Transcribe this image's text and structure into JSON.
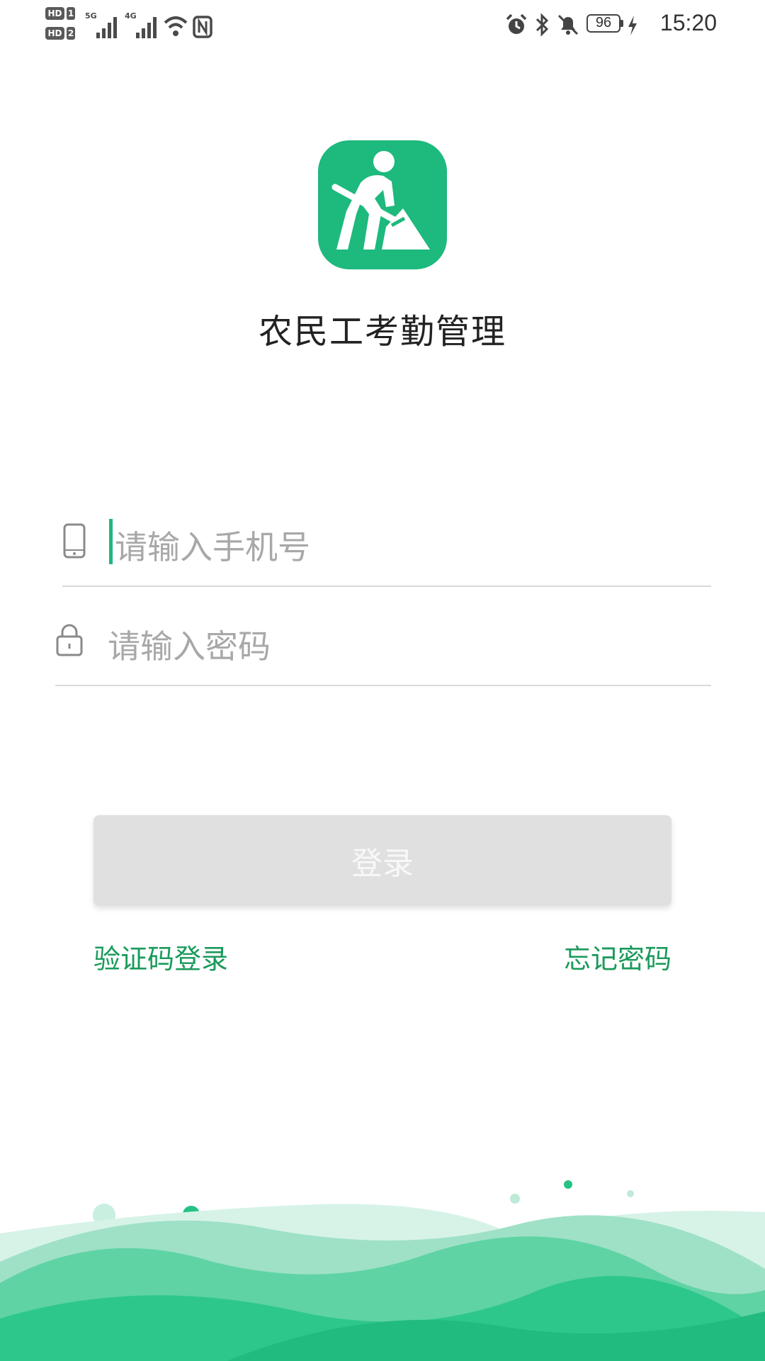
{
  "status_bar": {
    "sim1_badge": "HD",
    "sim1_num": "1",
    "sim2_badge": "HD",
    "sim2_num": "2",
    "net1_type": "5G",
    "net2_type": "4G",
    "battery_level": "96",
    "time": "15:20",
    "icons": [
      "signal-icon",
      "wifi-icon",
      "nfc-icon",
      "alarm-icon",
      "bluetooth-icon",
      "mute-bell-icon",
      "battery-icon",
      "charging-icon"
    ]
  },
  "app": {
    "title": "农民工考勤管理",
    "logo_icon": "worker-shovel-icon",
    "brand_color": "#1db97d"
  },
  "form": {
    "phone_placeholder": "请输入手机号",
    "phone_value": "",
    "phone_icon": "phone-icon",
    "password_placeholder": "请输入密码",
    "password_value": "",
    "password_icon": "lock-icon",
    "login_label": "登录",
    "sms_login_label": "验证码登录",
    "forgot_password_label": "忘记密码"
  }
}
